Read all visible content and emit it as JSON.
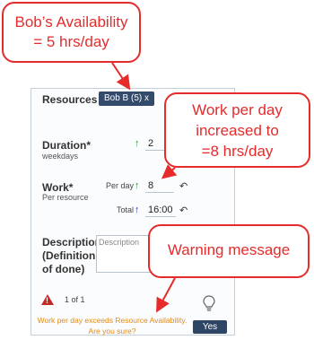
{
  "callouts": {
    "availability": {
      "line1": "Bob’s Availability",
      "line2": "= 5 hrs/day"
    },
    "work_per_day": {
      "line1": "Work per day",
      "line2": "increased to",
      "line3": "=8 hrs/day"
    },
    "warning": {
      "line1": "Warning message"
    }
  },
  "form": {
    "resources": {
      "label": "Resources",
      "chip": "Bob B (5) x"
    },
    "duration": {
      "label": "Duration*",
      "sublabel": "weekdays",
      "arrow": "↑",
      "value": "2"
    },
    "work": {
      "label": "Work*",
      "sublabel": "Per resource",
      "per_day": {
        "label": "Per day",
        "arrow": "↑",
        "value": "8",
        "undo": "↶"
      },
      "total": {
        "label": "Total",
        "arrow": "↑",
        "value": "16:00",
        "undo": "↶"
      }
    },
    "description": {
      "label_lines": [
        "Description",
        "(Definition",
        "of done)"
      ],
      "placeholder": "Description"
    }
  },
  "alert": {
    "count": "1 of 1",
    "triangle_mark": "!",
    "message_line1": "Work per day exceeds Resource Availability.",
    "message_line2": "Are you sure?",
    "yes_button": "Yes"
  },
  "colors": {
    "callout": "#e62b2b",
    "warning_text": "#e38a14",
    "chip": "#344a6a",
    "arrow_up_green": "#2e8b3a",
    "arrow_up_blue": "#2a3dbf"
  }
}
